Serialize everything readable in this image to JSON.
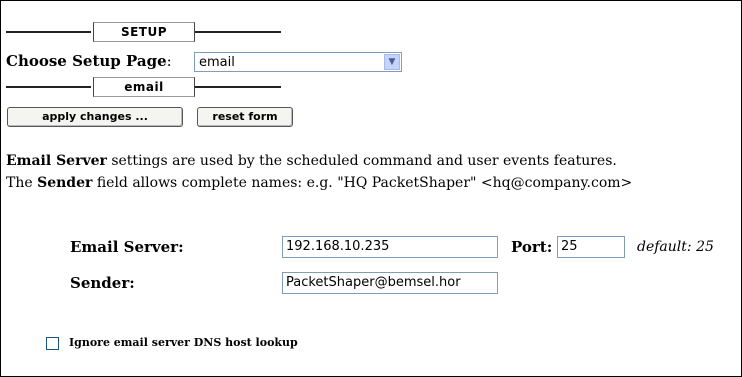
{
  "setup_header": {
    "label": "SETUP"
  },
  "choose_setup": {
    "label": "Choose Setup Page",
    "colon": ":",
    "selected": "email"
  },
  "email_header": {
    "label": "email"
  },
  "buttons": {
    "apply": "apply changes ...",
    "reset": "reset form"
  },
  "description": {
    "line1_bold": "Email Server",
    "line1_rest": " settings are used by the scheduled command and user events features.",
    "line2_pre": "The ",
    "line2_bold": "Sender",
    "line2_rest": " field allows complete names: e.g. \"HQ PacketShaper\" <hq@company.com>"
  },
  "form": {
    "email_server_label": "Email Server:",
    "email_server_value": "192.168.10.235",
    "port_label": "Port",
    "port_colon": ":",
    "port_value": "25",
    "default_label": "default:",
    "default_value": "25",
    "sender_label": "Sender:",
    "sender_value": "PacketShaper@bemsel.hor"
  },
  "options": {
    "ignore_dns_label": "Ignore email server DNS host lookup",
    "ignore_dns_checked": false
  }
}
